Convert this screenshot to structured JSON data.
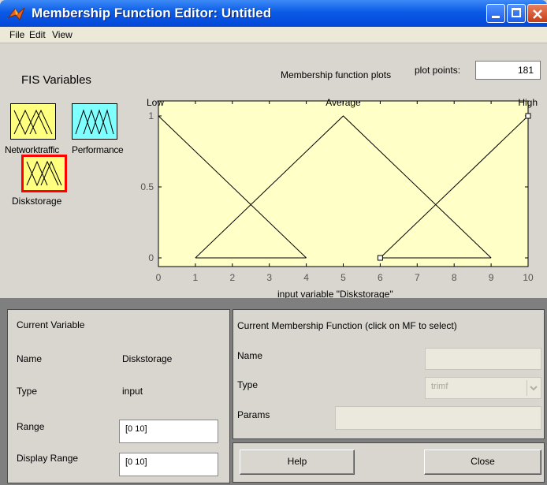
{
  "window": {
    "title": "Membership Function Editor: Untitled"
  },
  "menu": [
    "File",
    "Edit",
    "View"
  ],
  "fis": {
    "heading": "FIS Variables",
    "variables": [
      {
        "name": "Networktraffic",
        "kind": "input"
      },
      {
        "name": "Performance",
        "kind": "output"
      },
      {
        "name": "Diskstorage",
        "kind": "input",
        "selected": true
      }
    ]
  },
  "plot": {
    "title": "Membership function plots",
    "plot_points_label": "plot points:",
    "plot_points_value": "181",
    "xlabel": "input variable \"Diskstorage\""
  },
  "chart_data": {
    "type": "line",
    "xlim": [
      0,
      10
    ],
    "ylim": [
      0,
      1
    ],
    "xticks": [
      0,
      1,
      2,
      3,
      4,
      5,
      6,
      7,
      8,
      9,
      10
    ],
    "yticks": [
      0,
      0.5,
      1
    ],
    "series": [
      {
        "name": "Low",
        "points": [
          [
            0,
            1
          ],
          [
            4,
            0
          ]
        ]
      },
      {
        "name": "Average",
        "points": [
          [
            1,
            0
          ],
          [
            5,
            1
          ],
          [
            9,
            0
          ]
        ]
      },
      {
        "name": "High",
        "points": [
          [
            6,
            0
          ],
          [
            10,
            1
          ]
        ]
      }
    ],
    "baselines": [
      [
        1,
        4
      ],
      [
        6,
        9
      ]
    ],
    "selected_series": "High",
    "background": "#ffffc8",
    "grid": false
  },
  "current_variable": {
    "heading": "Current Variable",
    "name_label": "Name",
    "name_value": "Diskstorage",
    "type_label": "Type",
    "type_value": "input",
    "range_label": "Range",
    "range_value": "[0 10]",
    "display_range_label": "Display Range",
    "display_range_value": "[0 10]"
  },
  "current_mf": {
    "heading": "Current Membership Function (click on MF to select)",
    "name_label": "Name",
    "name_value": "",
    "type_label": "Type",
    "type_value": "trimf",
    "params_label": "Params",
    "params_value": ""
  },
  "buttons": {
    "help": "Help",
    "close": "Close"
  },
  "colors": {
    "plot_bg": "#ffffc8",
    "input_icon": "#ffff80",
    "output_icon": "#80ffff",
    "selected_border": "#ff0000"
  }
}
